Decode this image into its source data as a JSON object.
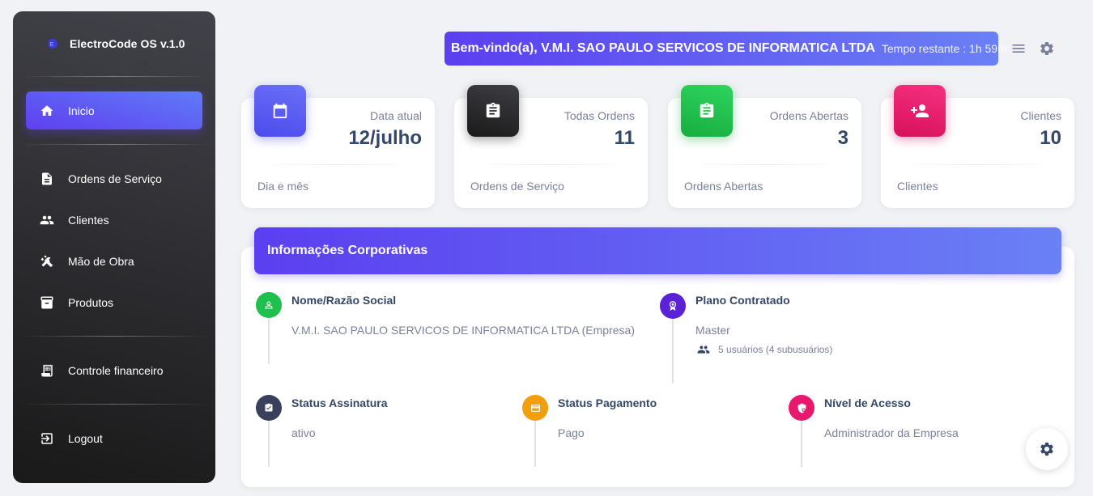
{
  "sidebar": {
    "brand": "ElectroCode OS v.1.0",
    "items": [
      {
        "label": "Inicio",
        "icon": "home-icon"
      },
      {
        "label": "Ordens de Serviço",
        "icon": "document-icon"
      },
      {
        "label": "Clientes",
        "icon": "people-icon"
      },
      {
        "label": "Mão de Obra",
        "icon": "tools-icon"
      },
      {
        "label": "Produtos",
        "icon": "archive-icon"
      },
      {
        "label": "Controle financeiro",
        "icon": "receipt-icon"
      },
      {
        "label": "Logout",
        "icon": "logout-icon"
      }
    ]
  },
  "header": {
    "welcome": "Bem-vindo(a), V.M.I. SAO PAULO SERVICOS DE INFORMATICA LTDA",
    "time_left": "Tempo restante : 1h 59m"
  },
  "cards": [
    {
      "label": "Data atual",
      "value": "12/julho",
      "footer": "Dia e mês",
      "icon": "calendar-icon",
      "color": "#5b5ff2"
    },
    {
      "label": "Todas Ordens",
      "value": "11",
      "footer": "Ordens de Serviço",
      "icon": "clipboard-icon",
      "color": "#2b2b2f"
    },
    {
      "label": "Ordens Abertas",
      "value": "3",
      "footer": "Ordens Abertas",
      "icon": "clipboard-list-icon",
      "color": "#1fc04d"
    },
    {
      "label": "Clientes",
      "value": "10",
      "footer": "Clientes",
      "icon": "person-add-icon",
      "color": "#e8196c"
    }
  ],
  "corporate": {
    "title": "Informações Corporativas",
    "name_title": "Nome/Razão Social",
    "name_value": "V.M.I. SAO PAULO SERVICOS DE INFORMATICA LTDA (Empresa)",
    "plan_title": "Plano Contratado",
    "plan_value": "Master",
    "plan_users": "5 usuários (4 subusuários)",
    "status_title": "Status Assinatura",
    "status_value": "ativo",
    "payment_title": "Status Pagamento",
    "payment_value": "Pago",
    "access_title": "Nível de Acesso",
    "access_value": "Administrador da Empresa"
  },
  "colors": {
    "accent": "#5b3ff0",
    "green": "#1fc04d",
    "purple": "#5b21d6",
    "dark": "#3a3f5c",
    "orange": "#f59e0b",
    "pink": "#e8196c"
  }
}
